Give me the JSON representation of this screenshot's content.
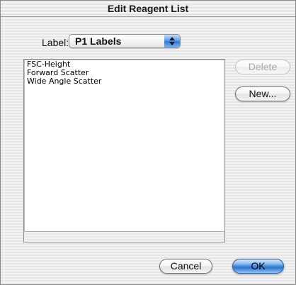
{
  "dialog": {
    "title": "Edit Reagent List"
  },
  "label_field": {
    "label": "Label:",
    "selected_value": "P1 Labels",
    "arrow_icon": "up-down-arrows-icon"
  },
  "list": {
    "items": [
      "FSC-Height",
      "Forward Scatter",
      "Wide Angle Scatter"
    ]
  },
  "buttons": {
    "delete_label": "Delete",
    "new_label": "New...",
    "cancel_label": "Cancel",
    "ok_label": "OK"
  }
}
